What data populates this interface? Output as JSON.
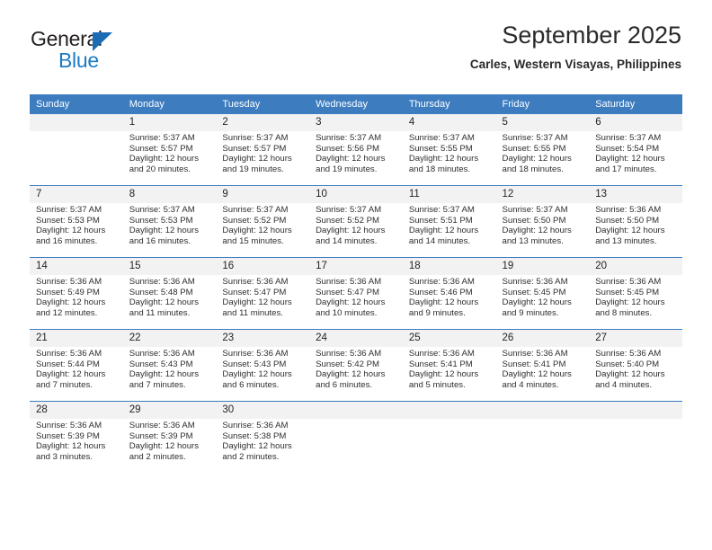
{
  "brand": {
    "name_top": "General",
    "name_bottom": "Blue",
    "triangle_color": "#1b6cb3",
    "blue_color": "#1b7bc4"
  },
  "header": {
    "title": "September 2025",
    "subtitle": "Carles, Western Visayas, Philippines"
  },
  "theme": {
    "header_blue": "#3c7cbf",
    "daynum_bg": "#f2f2f2",
    "text": "#231f20"
  },
  "weekday_headers": [
    "Sunday",
    "Monday",
    "Tuesday",
    "Wednesday",
    "Thursday",
    "Friday",
    "Saturday"
  ],
  "labels": {
    "sunrise_prefix": "Sunrise:",
    "sunset_prefix": "Sunset:",
    "daylight_prefix": "Daylight:"
  },
  "weeks": [
    [
      {
        "day": "",
        "sunrise": "",
        "sunset": "",
        "daylight_line1": "",
        "daylight_line2": ""
      },
      {
        "day": "1",
        "sunrise": "Sunrise: 5:37 AM",
        "sunset": "Sunset: 5:57 PM",
        "daylight_line1": "Daylight: 12 hours",
        "daylight_line2": "and 20 minutes."
      },
      {
        "day": "2",
        "sunrise": "Sunrise: 5:37 AM",
        "sunset": "Sunset: 5:57 PM",
        "daylight_line1": "Daylight: 12 hours",
        "daylight_line2": "and 19 minutes."
      },
      {
        "day": "3",
        "sunrise": "Sunrise: 5:37 AM",
        "sunset": "Sunset: 5:56 PM",
        "daylight_line1": "Daylight: 12 hours",
        "daylight_line2": "and 19 minutes."
      },
      {
        "day": "4",
        "sunrise": "Sunrise: 5:37 AM",
        "sunset": "Sunset: 5:55 PM",
        "daylight_line1": "Daylight: 12 hours",
        "daylight_line2": "and 18 minutes."
      },
      {
        "day": "5",
        "sunrise": "Sunrise: 5:37 AM",
        "sunset": "Sunset: 5:55 PM",
        "daylight_line1": "Daylight: 12 hours",
        "daylight_line2": "and 18 minutes."
      },
      {
        "day": "6",
        "sunrise": "Sunrise: 5:37 AM",
        "sunset": "Sunset: 5:54 PM",
        "daylight_line1": "Daylight: 12 hours",
        "daylight_line2": "and 17 minutes."
      }
    ],
    [
      {
        "day": "7",
        "sunrise": "Sunrise: 5:37 AM",
        "sunset": "Sunset: 5:53 PM",
        "daylight_line1": "Daylight: 12 hours",
        "daylight_line2": "and 16 minutes."
      },
      {
        "day": "8",
        "sunrise": "Sunrise: 5:37 AM",
        "sunset": "Sunset: 5:53 PM",
        "daylight_line1": "Daylight: 12 hours",
        "daylight_line2": "and 16 minutes."
      },
      {
        "day": "9",
        "sunrise": "Sunrise: 5:37 AM",
        "sunset": "Sunset: 5:52 PM",
        "daylight_line1": "Daylight: 12 hours",
        "daylight_line2": "and 15 minutes."
      },
      {
        "day": "10",
        "sunrise": "Sunrise: 5:37 AM",
        "sunset": "Sunset: 5:52 PM",
        "daylight_line1": "Daylight: 12 hours",
        "daylight_line2": "and 14 minutes."
      },
      {
        "day": "11",
        "sunrise": "Sunrise: 5:37 AM",
        "sunset": "Sunset: 5:51 PM",
        "daylight_line1": "Daylight: 12 hours",
        "daylight_line2": "and 14 minutes."
      },
      {
        "day": "12",
        "sunrise": "Sunrise: 5:37 AM",
        "sunset": "Sunset: 5:50 PM",
        "daylight_line1": "Daylight: 12 hours",
        "daylight_line2": "and 13 minutes."
      },
      {
        "day": "13",
        "sunrise": "Sunrise: 5:36 AM",
        "sunset": "Sunset: 5:50 PM",
        "daylight_line1": "Daylight: 12 hours",
        "daylight_line2": "and 13 minutes."
      }
    ],
    [
      {
        "day": "14",
        "sunrise": "Sunrise: 5:36 AM",
        "sunset": "Sunset: 5:49 PM",
        "daylight_line1": "Daylight: 12 hours",
        "daylight_line2": "and 12 minutes."
      },
      {
        "day": "15",
        "sunrise": "Sunrise: 5:36 AM",
        "sunset": "Sunset: 5:48 PM",
        "daylight_line1": "Daylight: 12 hours",
        "daylight_line2": "and 11 minutes."
      },
      {
        "day": "16",
        "sunrise": "Sunrise: 5:36 AM",
        "sunset": "Sunset: 5:47 PM",
        "daylight_line1": "Daylight: 12 hours",
        "daylight_line2": "and 11 minutes."
      },
      {
        "day": "17",
        "sunrise": "Sunrise: 5:36 AM",
        "sunset": "Sunset: 5:47 PM",
        "daylight_line1": "Daylight: 12 hours",
        "daylight_line2": "and 10 minutes."
      },
      {
        "day": "18",
        "sunrise": "Sunrise: 5:36 AM",
        "sunset": "Sunset: 5:46 PM",
        "daylight_line1": "Daylight: 12 hours",
        "daylight_line2": "and 9 minutes."
      },
      {
        "day": "19",
        "sunrise": "Sunrise: 5:36 AM",
        "sunset": "Sunset: 5:45 PM",
        "daylight_line1": "Daylight: 12 hours",
        "daylight_line2": "and 9 minutes."
      },
      {
        "day": "20",
        "sunrise": "Sunrise: 5:36 AM",
        "sunset": "Sunset: 5:45 PM",
        "daylight_line1": "Daylight: 12 hours",
        "daylight_line2": "and 8 minutes."
      }
    ],
    [
      {
        "day": "21",
        "sunrise": "Sunrise: 5:36 AM",
        "sunset": "Sunset: 5:44 PM",
        "daylight_line1": "Daylight: 12 hours",
        "daylight_line2": "and 7 minutes."
      },
      {
        "day": "22",
        "sunrise": "Sunrise: 5:36 AM",
        "sunset": "Sunset: 5:43 PM",
        "daylight_line1": "Daylight: 12 hours",
        "daylight_line2": "and 7 minutes."
      },
      {
        "day": "23",
        "sunrise": "Sunrise: 5:36 AM",
        "sunset": "Sunset: 5:43 PM",
        "daylight_line1": "Daylight: 12 hours",
        "daylight_line2": "and 6 minutes."
      },
      {
        "day": "24",
        "sunrise": "Sunrise: 5:36 AM",
        "sunset": "Sunset: 5:42 PM",
        "daylight_line1": "Daylight: 12 hours",
        "daylight_line2": "and 6 minutes."
      },
      {
        "day": "25",
        "sunrise": "Sunrise: 5:36 AM",
        "sunset": "Sunset: 5:41 PM",
        "daylight_line1": "Daylight: 12 hours",
        "daylight_line2": "and 5 minutes."
      },
      {
        "day": "26",
        "sunrise": "Sunrise: 5:36 AM",
        "sunset": "Sunset: 5:41 PM",
        "daylight_line1": "Daylight: 12 hours",
        "daylight_line2": "and 4 minutes."
      },
      {
        "day": "27",
        "sunrise": "Sunrise: 5:36 AM",
        "sunset": "Sunset: 5:40 PM",
        "daylight_line1": "Daylight: 12 hours",
        "daylight_line2": "and 4 minutes."
      }
    ],
    [
      {
        "day": "28",
        "sunrise": "Sunrise: 5:36 AM",
        "sunset": "Sunset: 5:39 PM",
        "daylight_line1": "Daylight: 12 hours",
        "daylight_line2": "and 3 minutes."
      },
      {
        "day": "29",
        "sunrise": "Sunrise: 5:36 AM",
        "sunset": "Sunset: 5:39 PM",
        "daylight_line1": "Daylight: 12 hours",
        "daylight_line2": "and 2 minutes."
      },
      {
        "day": "30",
        "sunrise": "Sunrise: 5:36 AM",
        "sunset": "Sunset: 5:38 PM",
        "daylight_line1": "Daylight: 12 hours",
        "daylight_line2": "and 2 minutes."
      },
      {
        "day": "",
        "sunrise": "",
        "sunset": "",
        "daylight_line1": "",
        "daylight_line2": ""
      },
      {
        "day": "",
        "sunrise": "",
        "sunset": "",
        "daylight_line1": "",
        "daylight_line2": ""
      },
      {
        "day": "",
        "sunrise": "",
        "sunset": "",
        "daylight_line1": "",
        "daylight_line2": ""
      },
      {
        "day": "",
        "sunrise": "",
        "sunset": "",
        "daylight_line1": "",
        "daylight_line2": ""
      }
    ]
  ]
}
